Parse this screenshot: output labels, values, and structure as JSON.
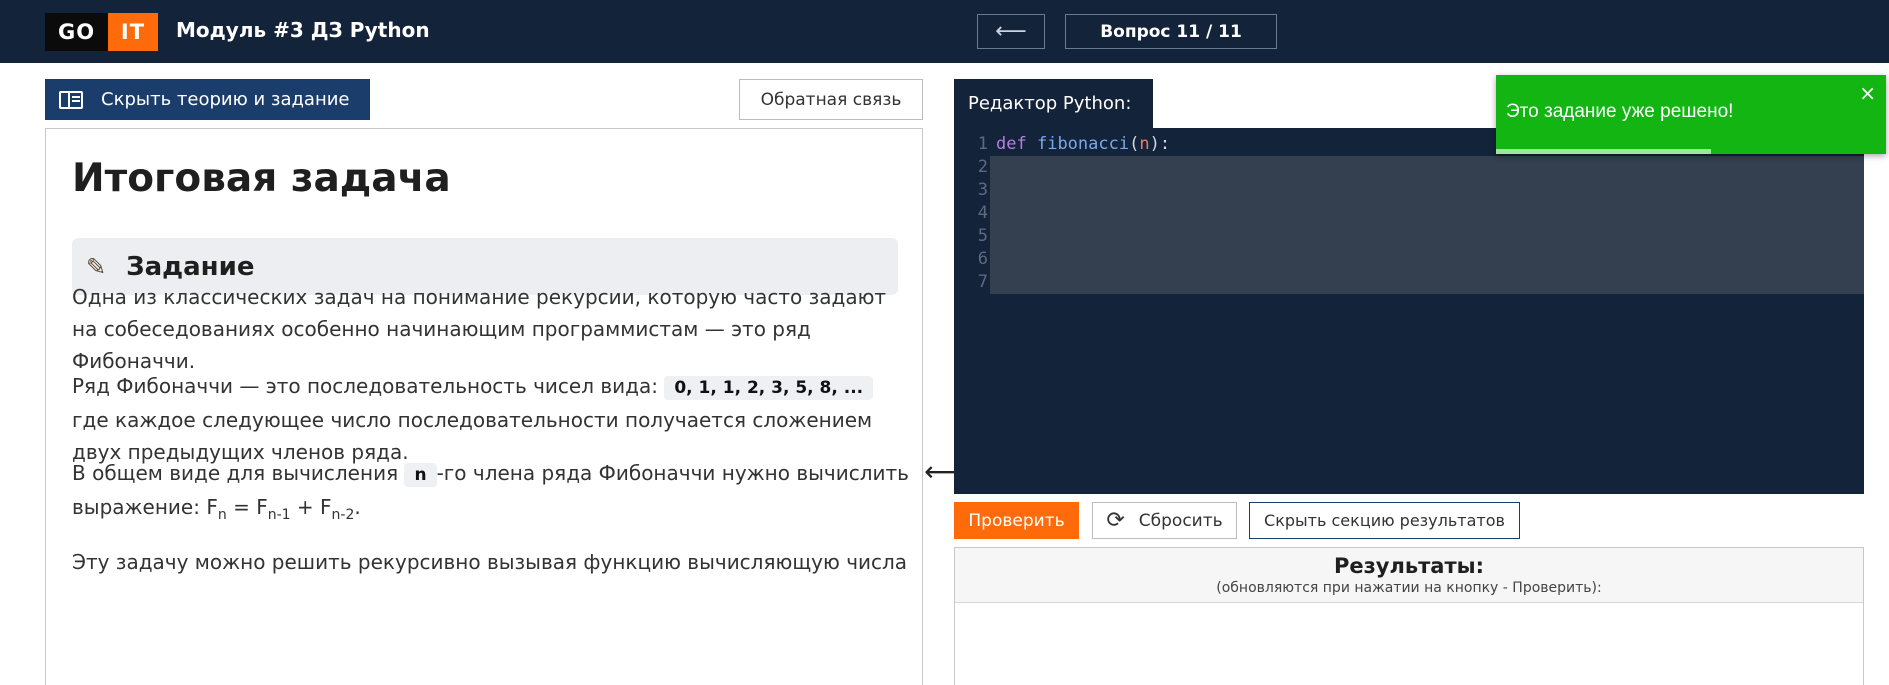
{
  "header": {
    "logo_go": "GO",
    "logo_it": "IT",
    "title": "Модуль #3 ДЗ Python",
    "back_arrow": "⟵",
    "question_counter": "Вопрос 11 / 11"
  },
  "left_panel": {
    "hide_theory_label": "Скрыть теорию и задание",
    "feedback_label": "Обратная связь",
    "heading": "Итоговая задача",
    "task_label": "Задание",
    "task_icon": "pencil-icon",
    "paragraphs": {
      "p1": "Одна из классических задач на понимание рекурсии, которую часто задают на собеседованиях особенно начинающим программистам — это ряд Фибоначчи.",
      "p2_start": "Ряд Фибоначчи — это последовательность чисел вида: ",
      "p2_chip": "0, 1, 1, 2, 3, 5, 8, ...",
      "p2_end": " где каждое следующее число последовательности получается сложением двух предыдущих членов ряда.",
      "p3_start": "В общем виде для вычисления ",
      "p3_chip": "n",
      "p3_mid": "-го члена ряда Фибоначчи нужно вычислить выражение: F",
      "p3_sub1": "n",
      "p3_eq": " = F",
      "p3_sub2": "n-1",
      "p3_plus": " + F",
      "p3_sub3": "n-2",
      "p3_end": ".",
      "p4": "Эту задачу можно решить рекурсивно вызывая функцию вычисляющую числа"
    }
  },
  "editor": {
    "tab_label": "Редактор Python:",
    "lines": [
      {
        "num": "1",
        "kw": "def",
        "fn": "fibonacci",
        "open": "(",
        "param": "n",
        "close": "):"
      },
      {
        "num": "2"
      },
      {
        "num": "3"
      },
      {
        "num": "4"
      },
      {
        "num": "5"
      },
      {
        "num": "6"
      },
      {
        "num": "7"
      }
    ],
    "check_label": "Проверить",
    "reset_label": "Сбросить",
    "hide_results_label": "Скрыть секцию результатов"
  },
  "results": {
    "title": "Результаты:",
    "subtitle": "(обновляются при нажатии на кнопку - Проверить):"
  },
  "toast": {
    "message": "Это задание уже решено!",
    "close": "×",
    "progress": 0.55
  },
  "colors": {
    "header_bg": "#13233a",
    "accent_orange": "#ff6b0a",
    "nav_blue": "#1a3d6b",
    "success_green": "#13b513"
  }
}
